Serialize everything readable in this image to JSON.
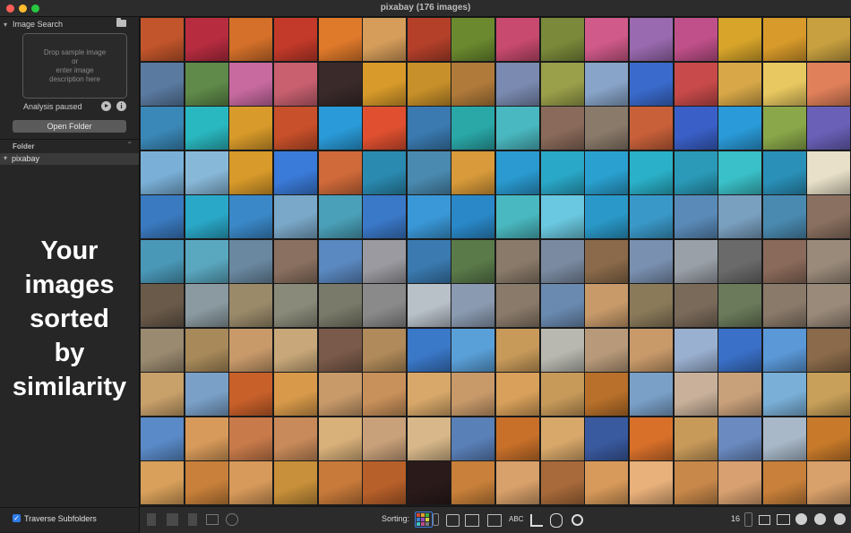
{
  "window": {
    "title": "pixabay (176 images)"
  },
  "sidebar": {
    "image_search_label": "Image Search",
    "dropzone_text": "Drop sample image\nor\nenter image\ndescription here",
    "analysis_status": "Analysis paused",
    "open_folder_label": "Open Folder",
    "folder_section_label": "Folder",
    "folder_tree": [
      {
        "label": "pixabay",
        "expanded": true
      }
    ],
    "tagline": "Your\nimages\nsorted\nby\nsimilarity",
    "traverse_subfolders_label": "Traverse Subfolders",
    "traverse_subfolders_checked": true
  },
  "grid": {
    "columns": 16,
    "rows": 11,
    "row_colors": [
      [
        "#c2552b",
        "#b82c40",
        "#d4702a",
        "#c43a2a",
        "#e07a2b",
        "#d59c5a",
        "#b4402a",
        "#6b8a2f",
        "#c84a6f",
        "#7a8a3a",
        "#d05a8a",
        "#9a6ab0",
        "#c0508a",
        "#d8a52a",
        "#d89a2a",
        "#c8a040"
      ],
      [
        "#5a7aa0",
        "#5f8a4a",
        "#c86aa0",
        "#c86070",
        "#3a2a2a",
        "#d89a2a",
        "#c8902a",
        "#b07a3a",
        "#7a8ab0",
        "#9aa04a",
        "#88a4c8",
        "#3a6acc",
        "#c84a4a",
        "#d8a848",
        "#e8c860",
        "#e0805a"
      ],
      [
        "#3a88b8",
        "#2ab8c0",
        "#d89a2a",
        "#c8502a",
        "#2a9ad8",
        "#e05030",
        "#3a7ab0",
        "#2aa8a8",
        "#4ab8c0",
        "#8a6a5a",
        "#8a7a6a",
        "#c8603a",
        "#3a60c8",
        "#2a9ad8",
        "#8aa84a",
        "#6a60b8"
      ],
      [
        "#7ab0d8",
        "#88b8d8",
        "#d89a2a",
        "#3a7ad8",
        "#d06a3a",
        "#2a8ab0",
        "#4a8ab0",
        "#d89a3a",
        "#2a9ad0",
        "#2aa8c8",
        "#2aa0d0",
        "#2ab0c8",
        "#2a9ab8",
        "#3ac0c8",
        "#2a90b8",
        "#e8e0c8"
      ],
      [
        "#3a7ac0",
        "#2aa8c8",
        "#3a88c8",
        "#7aa8c8",
        "#4aa0b8",
        "#3a78c8",
        "#3a98d8",
        "#2a88c8",
        "#4ab8c0",
        "#6ac8e0",
        "#2a98c8",
        "#3a98c8",
        "#5a8ab8",
        "#7aa0c0",
        "#4a8ab0",
        "#8a7060"
      ],
      [
        "#4a98b8",
        "#5aa8c0",
        "#6a88a0",
        "#8a7060",
        "#5a88c0",
        "#9a9aa0",
        "#3a7ab0",
        "#5a7a4a",
        "#8a7a6a",
        "#7a8aa0",
        "#8a6a4a",
        "#7a90b0",
        "#9aa0a8",
        "#6a6a6a",
        "#8a6a5a",
        "#9a8a7a"
      ],
      [
        "#6a5a4a",
        "#8a9aa0",
        "#9a8a6a",
        "#8a8a7a",
        "#7a7a6a",
        "#8a8a8a",
        "#b8c0c8",
        "#8a9ab0",
        "#8a7a6a",
        "#6a8ab0",
        "#c89a6a",
        "#8a7a5a",
        "#7a6a5a",
        "#6a7a5a",
        "#8a7a6a",
        "#9a8a7a"
      ],
      [
        "#9a8a70",
        "#a88a5a",
        "#c89a6a",
        "#c8a87a",
        "#7a5a4a",
        "#b08a5a",
        "#3a78c8",
        "#5aa0d8",
        "#c89a5a",
        "#b8b8b0",
        "#b89a7a",
        "#c89a6a",
        "#9ab0d0",
        "#3a70c8",
        "#5a98d8",
        "#8a6a4a"
      ],
      [
        "#c8a06a",
        "#7aa0c8",
        "#c8602a",
        "#d89a4a",
        "#c89a6a",
        "#c8905a",
        "#d8a86a",
        "#c89a6a",
        "#d8a05a",
        "#c89a5a",
        "#b8702a",
        "#7aa0c8",
        "#c8b09a",
        "#c8a07a",
        "#7ab0d8",
        "#c8a05a"
      ],
      [
        "#5a8ac8",
        "#d89a5a",
        "#c87a4a",
        "#c88a5a",
        "#d8b07a",
        "#c8a07a",
        "#d8b88a",
        "#5a80b8",
        "#c8702a",
        "#d8a86a",
        "#3a5aa0",
        "#d8702a",
        "#c89a5a",
        "#6a8ac0",
        "#a8b8c8",
        "#c87a2a"
      ],
      [
        "#d8a05a",
        "#c8803a",
        "#d89a5a",
        "#c8903a",
        "#c87a3a",
        "#b8602a",
        "#2a1a1a",
        "#c8803a",
        "#d8a06a",
        "#a86a3a",
        "#d89a5a",
        "#e8b07a",
        "#c8884a",
        "#d8a070",
        "#c8803a",
        "#d8a06a"
      ]
    ]
  },
  "toolbar": {
    "sorting_label": "Sorting:",
    "abc_label": "ABC",
    "zoom_value": "16"
  }
}
